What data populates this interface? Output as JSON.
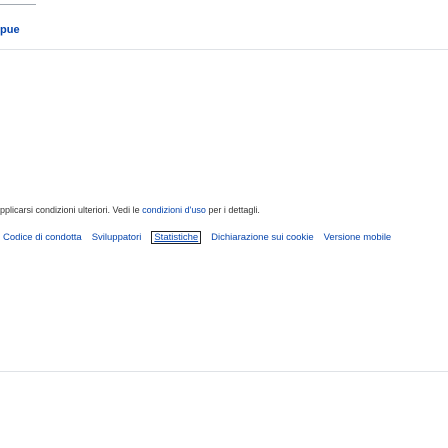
{
  "header": {
    "crumb_text": "pue"
  },
  "license": {
    "text_before": "pplicarsi condizioni ulteriori. Vedi le ",
    "link_text": "condizioni d'uso",
    "text_after": " per i dettagli."
  },
  "footer": {
    "links": [
      "Codice di condotta",
      "Sviluppatori",
      "Statistiche",
      "Dichiarazione sui cookie",
      "Versione mobile"
    ]
  },
  "colors": {
    "link": "#0645ad",
    "text": "#333333",
    "divider": "#dfe2e6"
  }
}
